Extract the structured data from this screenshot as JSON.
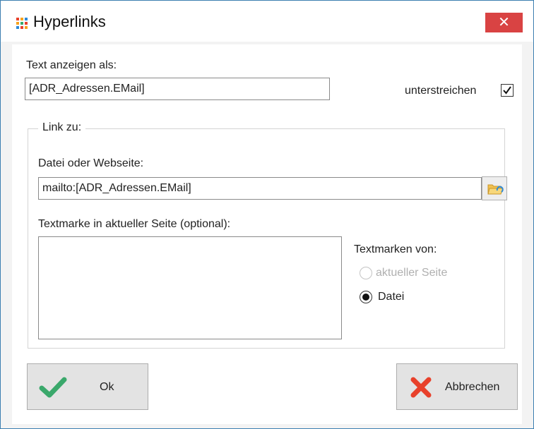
{
  "window": {
    "title": "Hyperlinks",
    "close_label": "✕",
    "app_icon": "app-grid-icon"
  },
  "display_text": {
    "label": "Text anzeigen als:",
    "value": "[ADR_Adressen.EMail]"
  },
  "underline": {
    "label": "unterstreichen",
    "checked": true
  },
  "link_group": {
    "legend": "Link zu:",
    "file_label": "Datei oder Webseite:",
    "file_value": "mailto:[ADR_Adressen.EMail]",
    "browse_icon": "folder-open-icon",
    "bookmark_label": "Textmarke in aktueller Seite (optional):",
    "bookmark_items": [],
    "bookmarks_from_label": "Textmarken von:",
    "options": [
      {
        "label": "aktueller Seite",
        "selected": false,
        "enabled": false
      },
      {
        "label": "Datei",
        "selected": true,
        "enabled": true
      }
    ]
  },
  "buttons": {
    "ok_label": "Ok",
    "ok_icon": "checkmark-icon",
    "cancel_label": "Abbrechen",
    "cancel_icon": "cross-icon"
  },
  "colors": {
    "accent_border": "#3c7fb1",
    "close_red": "#d94343",
    "check_green": "#3aa86b",
    "cancel_red": "#e8412b"
  }
}
